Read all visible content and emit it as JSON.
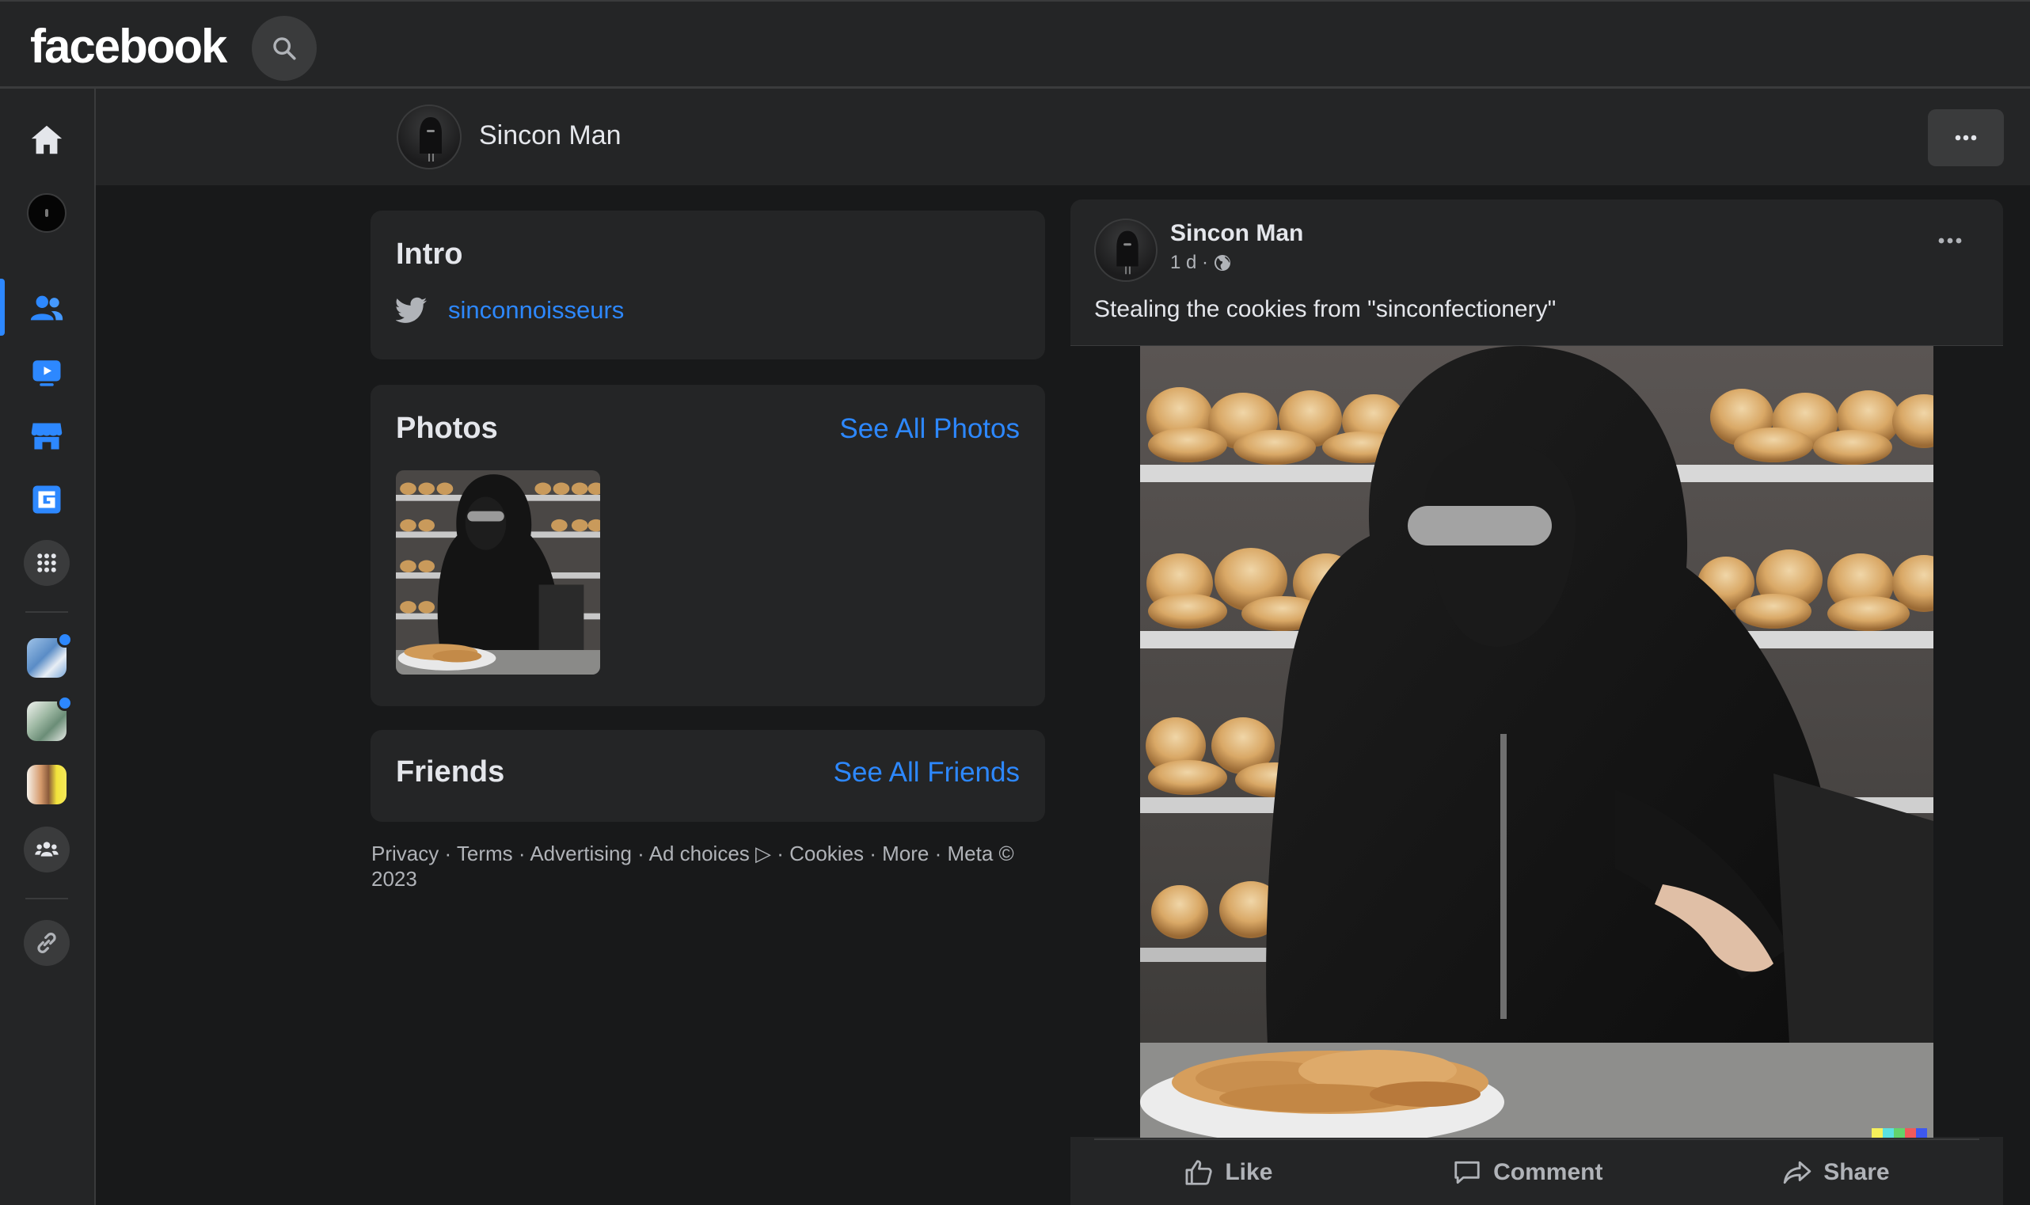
{
  "header": {
    "logo": "facebook"
  },
  "profile": {
    "name": "Sincon Man"
  },
  "intro": {
    "title": "Intro",
    "twitter_handle": "sinconnoisseurs"
  },
  "photos": {
    "title": "Photos",
    "see_all": "See All Photos"
  },
  "friends": {
    "title": "Friends",
    "see_all": "See All Friends"
  },
  "footer": {
    "text": "Privacy · Terms · Advertising · Ad choices ▷ · Cookies · More · Meta © 2023"
  },
  "post": {
    "author": "Sincon Man",
    "time": "1 d ·",
    "text": "Stealing the cookies from \"sinconfectionery\"",
    "actions": {
      "like": "Like",
      "comment": "Comment",
      "share": "Share"
    }
  },
  "colors": {
    "background": "#18191a",
    "surface": "#242526",
    "accent": "#2d88ff",
    "text_primary": "#e4e6eb",
    "text_secondary": "#b0b3b8"
  },
  "icons": {
    "search": "search-icon",
    "home": "home-icon",
    "friends": "friends-icon",
    "watch": "watch-icon",
    "marketplace": "marketplace-icon",
    "gaming": "gaming-icon",
    "menu": "grid-menu-icon",
    "groups": "groups-icon",
    "link": "link-icon",
    "twitter": "twitter-icon",
    "globe": "globe-icon",
    "more": "more-horizontal-icon"
  }
}
